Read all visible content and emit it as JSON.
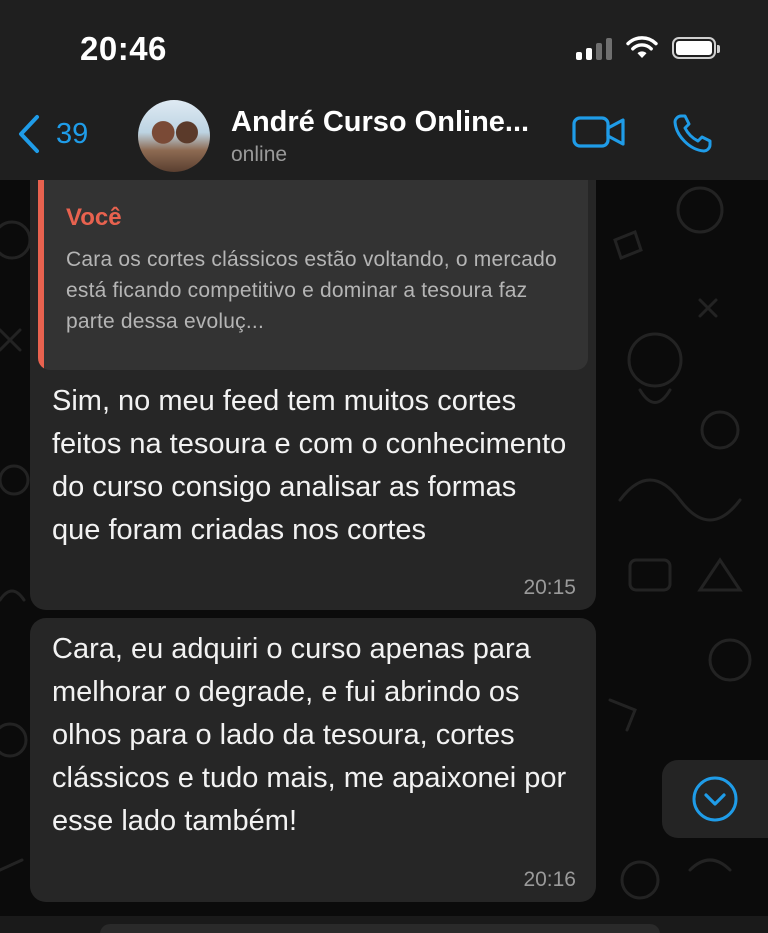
{
  "status_bar": {
    "time": "20:46"
  },
  "chat_header": {
    "back_count": "39",
    "contact_name": "André Curso Online...",
    "presence": "online",
    "icons": {
      "back": "chevron-left-icon",
      "video": "video-camera-icon",
      "call": "phone-icon"
    },
    "accent_color": "#1f9ce8"
  },
  "messages": [
    {
      "quote": {
        "author": "Você",
        "text": "Cara os cortes clássicos estão voltando, o mercado está ficando competitivo e dominar a tesoura faz parte dessa evoluç...",
        "author_color": "#e8624f"
      },
      "text": "Sim, no meu feed tem muitos cortes feitos na tesoura e com o conhecimento do curso consigo analisar as formas que foram criadas nos cortes",
      "time": "20:15"
    },
    {
      "text": "Cara, eu adquiri o curso apenas para melhorar o degrade, e fui abrindo os olhos para o lado da tesoura, cortes clássicos e tudo mais, me apaixonei por esse lado também!",
      "time": "20:16"
    }
  ],
  "scroll_down_icon": "chevron-down-circle-icon"
}
